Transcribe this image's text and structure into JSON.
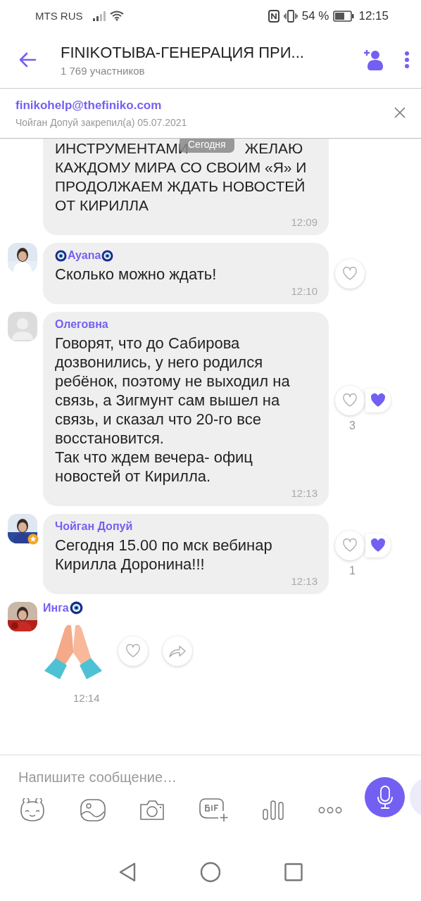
{
  "status_bar": {
    "carrier": "MTS RUS",
    "battery": "54 %",
    "time": "12:15"
  },
  "header": {
    "title": "FINIKOТЫВА-ГЕНЕРАЦИЯ ПРИ...",
    "subtitle": "1 769 участников"
  },
  "pinned": {
    "text": "finikohelp@thefiniko.com",
    "meta": "Чойган Допуй закрепил(а) 05.07.2021"
  },
  "date_badge": "Сегодня",
  "partial_message": {
    "lines": [
      "ИНСТРУМЕНТАМИ",
      "ЖЕЛАЮ",
      "КАЖДОМУ МИРА СО СВОИМ «Я» И",
      "ПРОДОЛЖАЕМ ЖДАТЬ НОВОСТЕЙ",
      "ОТ КИРИЛЛА"
    ],
    "time": "12:09"
  },
  "messages": [
    {
      "kind": "text",
      "sender": "Ayana",
      "amulet_before": true,
      "amulet_after": true,
      "admin": false,
      "default_avatar": false,
      "text": "Сколько можно ждать!",
      "time": "12:10",
      "liked": false
    },
    {
      "kind": "text",
      "sender": "Олеговна",
      "amulet_before": false,
      "amulet_after": false,
      "admin": false,
      "default_avatar": true,
      "text": "Говорят, что до Сабирова дозвонились, у него родился ребёнок, поэтому не выходил на связь, а Зигмунт сам вышел на связь, и сказал что 20-го все восстановится.\nТак что ждем вечера- офиц новостей от Кирилла.",
      "time": "12:13",
      "liked": true,
      "like_count": "3"
    },
    {
      "kind": "text",
      "sender": "Чойган Допуй",
      "amulet_before": false,
      "amulet_after": false,
      "admin": true,
      "default_avatar": false,
      "text": "Сегодня 15.00 по мск вебинар Кирилла Доронина!!!",
      "time": "12:13",
      "liked": true,
      "like_count": "1"
    },
    {
      "kind": "sticker",
      "sender": "Инга",
      "amulet_before": false,
      "amulet_after": true,
      "admin": false,
      "default_avatar": false,
      "time": "12:14",
      "liked": false
    }
  ],
  "composer": {
    "placeholder": "Напишите сообщение…"
  }
}
